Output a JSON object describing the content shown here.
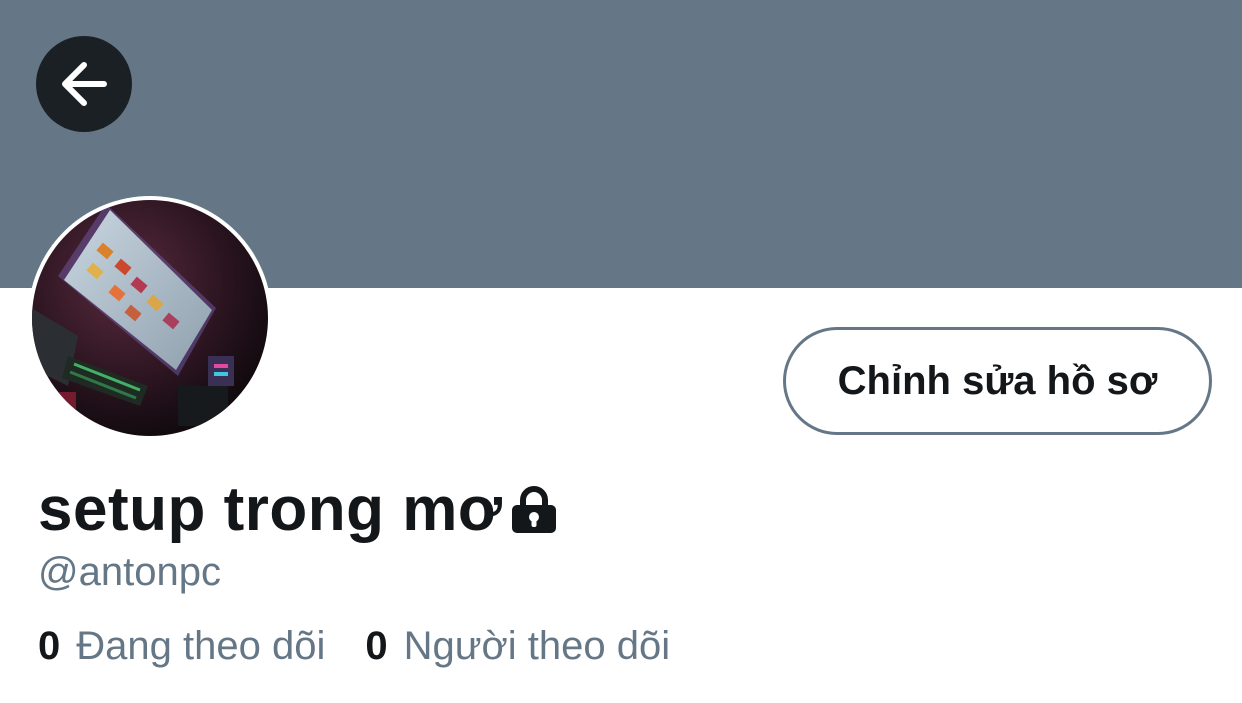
{
  "header": {
    "banner_color": "#657786",
    "back_icon": "arrow-left-icon"
  },
  "profile": {
    "display_name": "setup trong mơ",
    "protected_icon": "lock-icon",
    "handle": "@antonpc",
    "edit_button_label": "Chỉnh sửa hồ sơ",
    "avatar_icon": "avatar-photo"
  },
  "stats": [
    {
      "count": "0",
      "label": "Đang theo dõi"
    },
    {
      "count": "0",
      "label": "Người theo dõi"
    }
  ],
  "colors": {
    "text_primary": "#14171a",
    "text_secondary": "#657786",
    "back_button_bg": "#1b2025"
  }
}
